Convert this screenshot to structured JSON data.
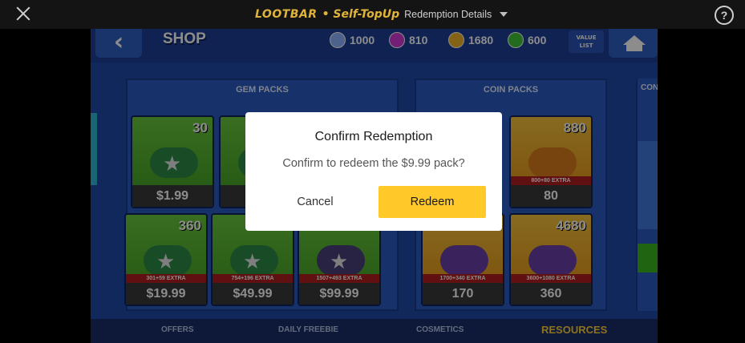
{
  "topbar": {
    "logo": "LOOTBAR",
    "logo_sub": "• Self-TopUp",
    "breadcrumb": "Redemption Details",
    "help_glyph": "?"
  },
  "game": {
    "back_glyph": "‹",
    "shop_title": "SHOP",
    "currencies": [
      {
        "value": "1000",
        "icon": "star-points-icon",
        "color": "#8fb4ff"
      },
      {
        "value": "810",
        "icon": "power-points-icon",
        "color": "#d23ad8"
      },
      {
        "value": "1680",
        "icon": "coins-icon",
        "color": "#f0b52a"
      },
      {
        "value": "600",
        "icon": "gems-icon",
        "color": "#3fc43a"
      }
    ],
    "value_list_line1": "VALUE",
    "value_list_line2": "LIST",
    "panels": {
      "gem_title": "GEM PACKS",
      "coin_title": "COIN PACKS",
      "third_title": "CON"
    },
    "gem_cards": [
      {
        "qty": "30",
        "extra": "",
        "price": "$1.99"
      },
      {
        "qty": "",
        "extra": "",
        "price": "$4"
      },
      {
        "qty": "360",
        "extra": "301+59 EXTRA",
        "price": "$19.99"
      },
      {
        "qty": "",
        "extra": "754+196 EXTRA",
        "price": "$49.99"
      },
      {
        "qty": "",
        "extra": "1507+493 EXTRA",
        "price": "$99.99"
      }
    ],
    "coin_cards": [
      {
        "qty": "880",
        "extra": "800+80 EXTRA",
        "price": "80"
      },
      {
        "qty": "",
        "extra": "1700+340 EXTRA",
        "price": "170"
      },
      {
        "qty": "4680",
        "extra": "3600+1080 EXTRA",
        "price": "360"
      }
    ],
    "tabs": [
      "OFFERS",
      "DAILY FREEBIE",
      "COSMETICS",
      "RESOURCES"
    ],
    "colors": {
      "accent_tab": "#ffcf33",
      "background": "#1e4aa8"
    }
  },
  "dialog": {
    "title": "Confirm Redemption",
    "message": "Confirm to redeem the $9.99 pack?",
    "cancel_label": "Cancel",
    "redeem_label": "Redeem",
    "redeem_color": "#ffc929"
  }
}
